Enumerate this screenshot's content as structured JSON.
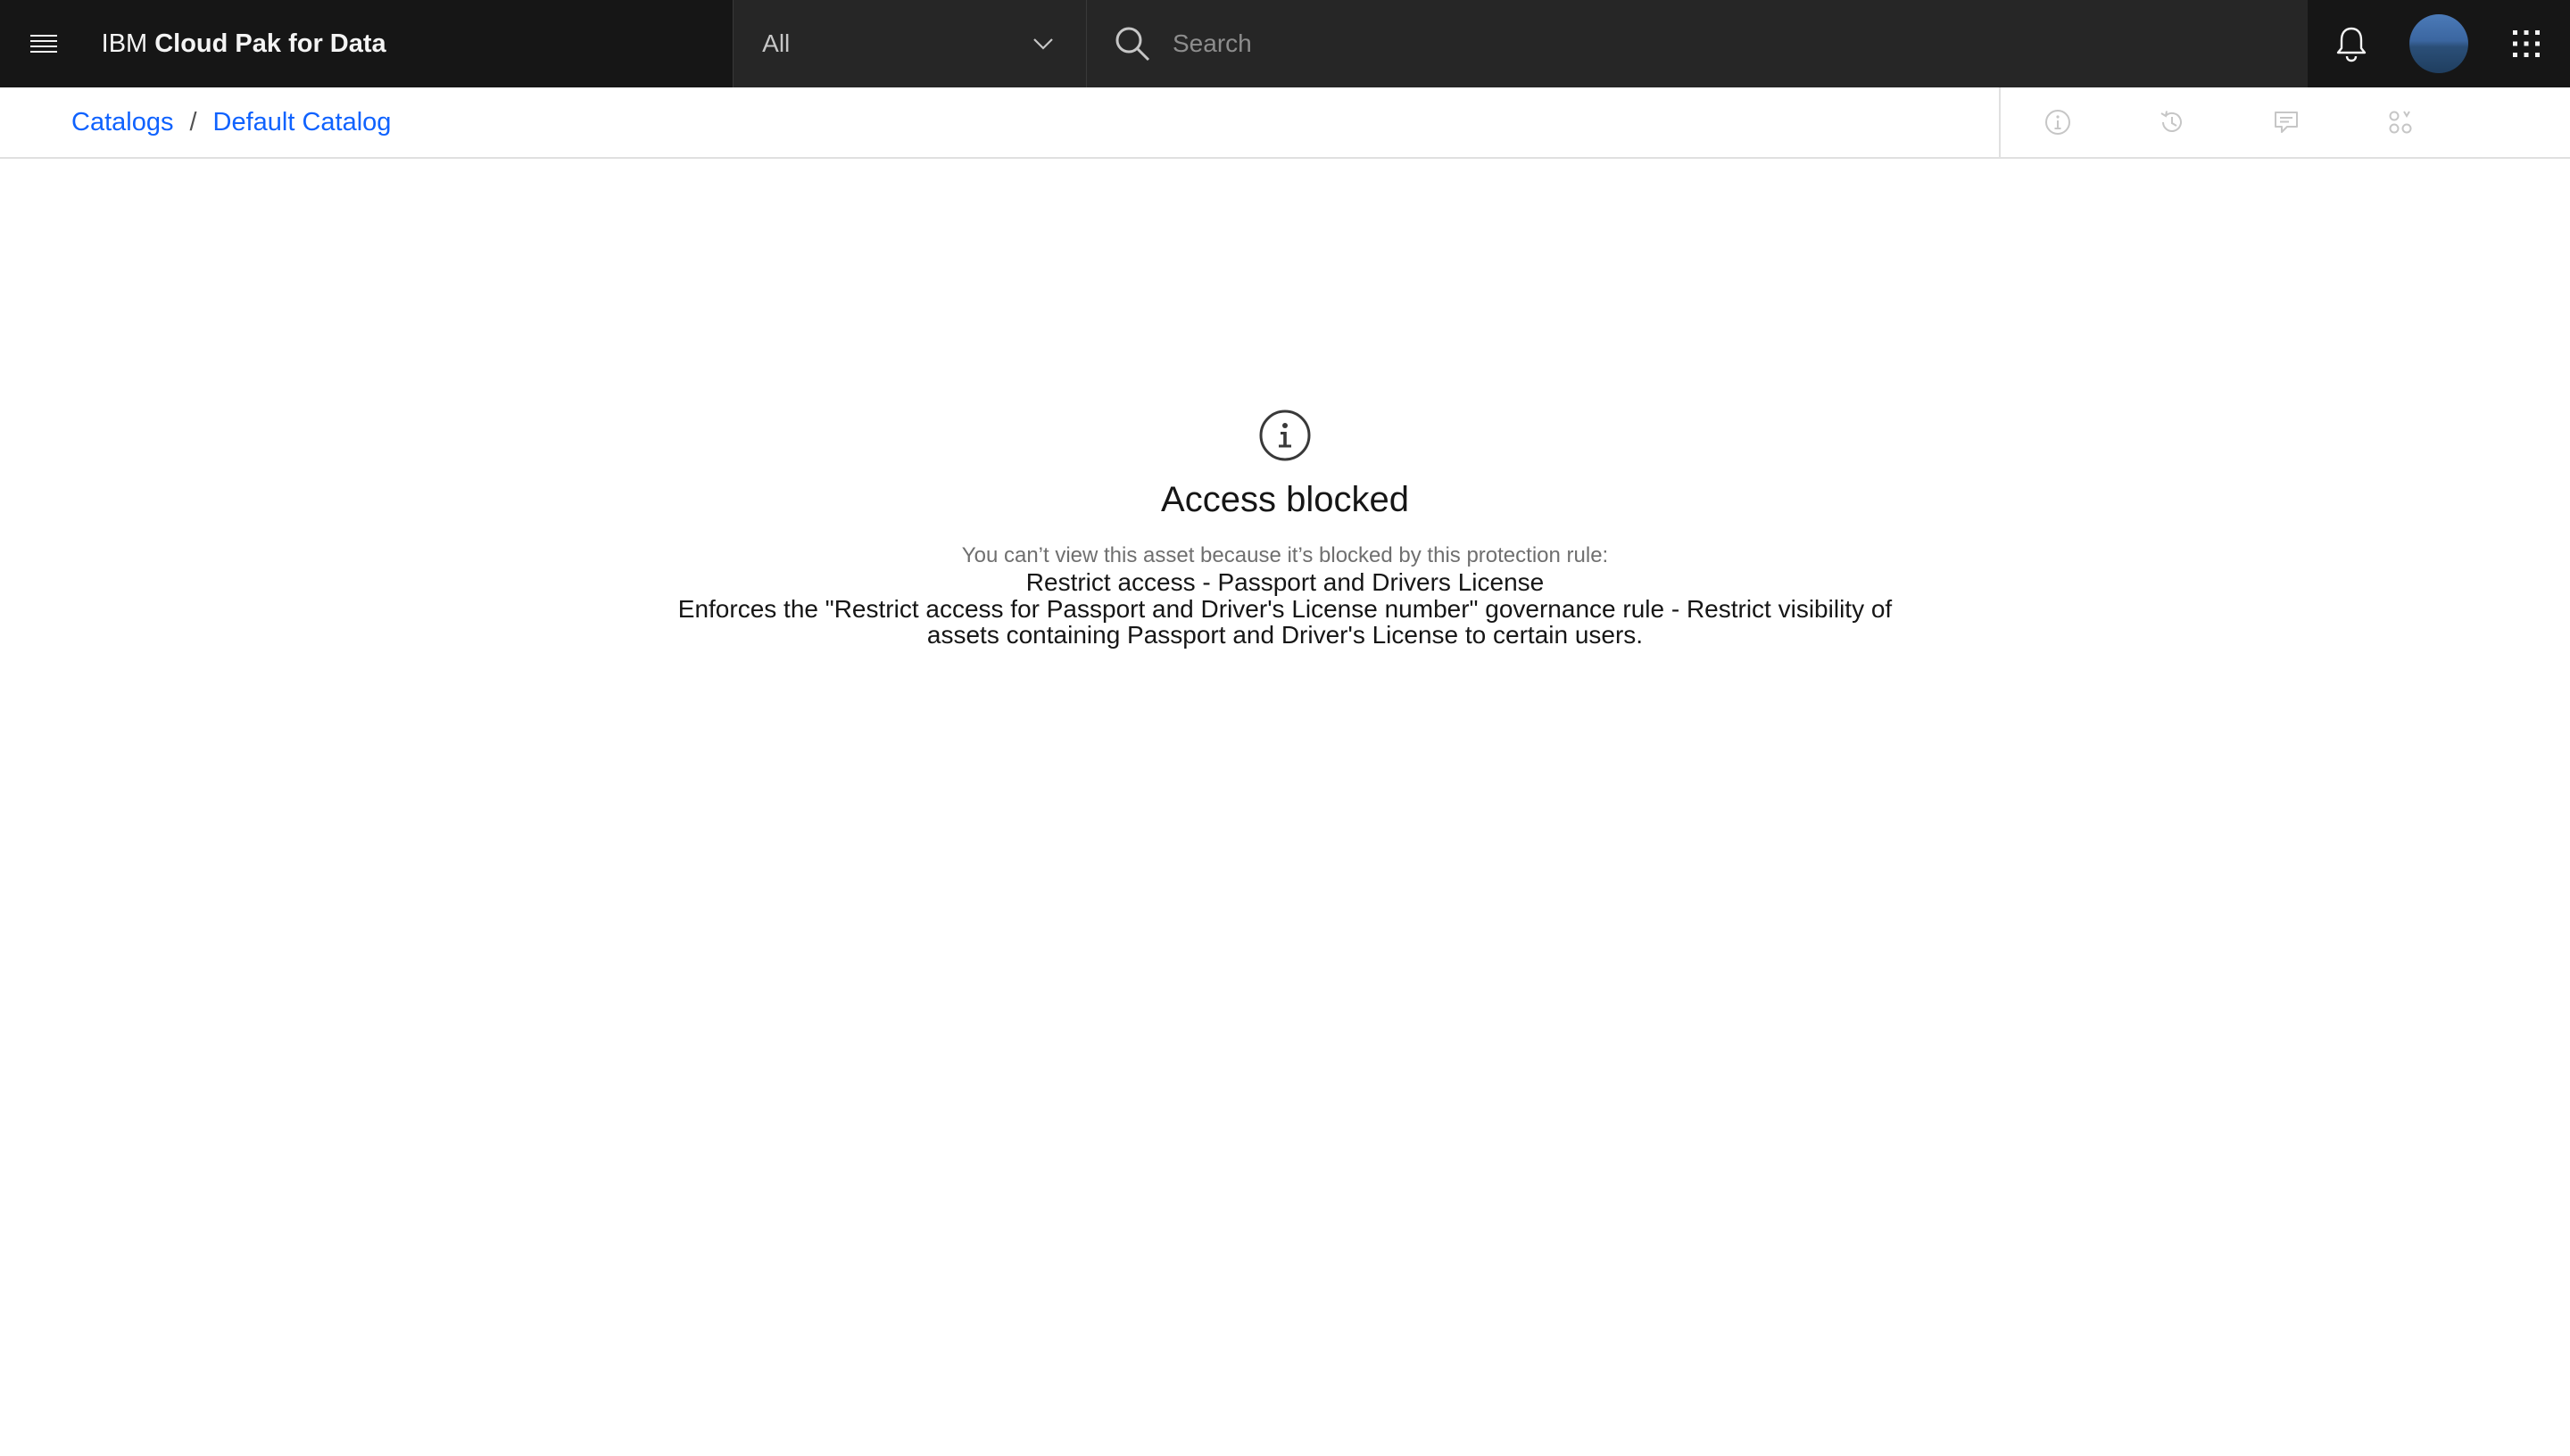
{
  "header": {
    "brand_prefix": "IBM",
    "brand_name": "Cloud Pak for Data",
    "scope_value": "All",
    "search_placeholder": "Search"
  },
  "breadcrumb": {
    "items": [
      "Catalogs",
      "Default Catalog"
    ],
    "separator": "/"
  },
  "empty_state": {
    "title": "Access blocked",
    "lead": "You can’t view this asset because it’s blocked by this protection rule:",
    "rule_name": "Restrict access - Passport and Drivers License",
    "rule_description": "Enforces the \"Restrict access for Passport and Driver's License number\" governance rule - Restrict visibility of assets containing Passport and Driver's License to certain users."
  },
  "colors": {
    "header_bg": "#161616",
    "link": "#0f62fe",
    "muted_text": "#6f6f6f"
  },
  "icons": {
    "menu": "hamburger-icon",
    "scope": "chevron-down-icon",
    "search": "search-icon",
    "notifications": "bell-icon",
    "apps": "app-switcher-icon",
    "tools": [
      "info-icon",
      "history-icon",
      "comment-icon",
      "related-icon"
    ]
  }
}
